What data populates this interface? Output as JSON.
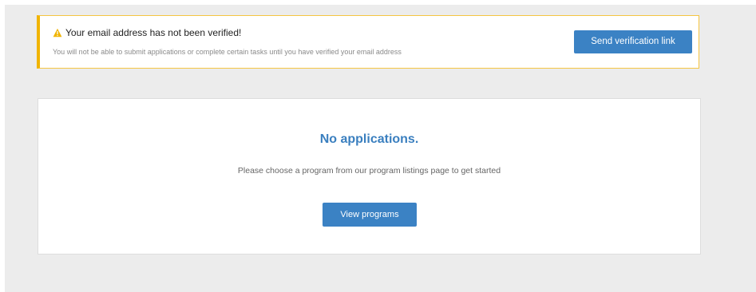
{
  "alert": {
    "title": "Your email address has not been verified!",
    "message": "You will not be able to submit applications or complete certain tasks until you have verified your email address",
    "icon": "warning-icon",
    "button_label": "Send verification link",
    "accent_color": "#f0b400"
  },
  "applications": {
    "empty_title": "No applications.",
    "empty_message": "Please choose a program from our program listings page to get started",
    "button_label": "View programs"
  },
  "colors": {
    "primary": "#3b82c4",
    "background": "#ececec"
  }
}
